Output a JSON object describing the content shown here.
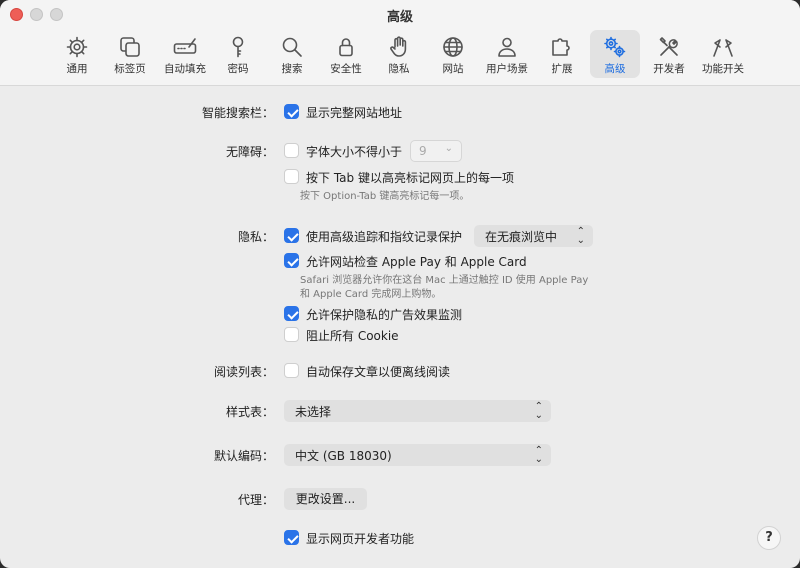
{
  "window": {
    "title": "高级"
  },
  "toolbar": {
    "tabs": [
      {
        "label": "通用",
        "icon": "gear-icon"
      },
      {
        "label": "标签页",
        "icon": "tabs-icon"
      },
      {
        "label": "自动填充",
        "icon": "pen-field-icon"
      },
      {
        "label": "密码",
        "icon": "key-icon"
      },
      {
        "label": "搜索",
        "icon": "search-icon"
      },
      {
        "label": "安全性",
        "icon": "lock-icon"
      },
      {
        "label": "隐私",
        "icon": "hand-icon"
      },
      {
        "label": "网站",
        "icon": "globe-icon"
      },
      {
        "label": "用户场景",
        "icon": "person-icon"
      },
      {
        "label": "扩展",
        "icon": "puzzle-icon"
      },
      {
        "label": "高级",
        "icon": "gears-icon",
        "active": true
      },
      {
        "label": "开发者",
        "icon": "wrench-screwdriver-icon"
      },
      {
        "label": "功能开关",
        "icon": "flags-icon"
      }
    ]
  },
  "settings": {
    "smart_search": {
      "label": "智能搜索栏：",
      "option": "显示完整网站地址",
      "checked": true
    },
    "accessibility": {
      "label": "无障碍：",
      "min_font": {
        "text": "字体大小不得小于",
        "checked": false,
        "value": "9"
      },
      "tab_highlight": {
        "text": "按下 Tab 键以高亮标记网页上的每一项",
        "checked": false
      },
      "tab_note": "按下 Option-Tab 键高亮标记每一项。"
    },
    "privacy": {
      "label": "隐私：",
      "tracking": {
        "text": "使用高级追踪和指纹记录保护",
        "checked": true,
        "popup": "在无痕浏览中"
      },
      "apple_pay": {
        "text": "允许网站检查 Apple Pay 和 Apple Card",
        "checked": true
      },
      "apple_pay_note_1": "Safari 浏览器允许你在这台 Mac 上通过触控 ID 使用 Apple Pay",
      "apple_pay_note_2": "和 Apple Card 完成网上购物。",
      "ad_measurement": {
        "text": "允许保护隐私的广告效果监测",
        "checked": true
      },
      "block_cookies": {
        "text": "阻止所有 Cookie",
        "checked": false
      }
    },
    "reading_list": {
      "label": "阅读列表：",
      "option": "自动保存文章以便离线阅读",
      "checked": false
    },
    "style_sheet": {
      "label": "样式表：",
      "value": "未选择"
    },
    "encoding": {
      "label": "默认编码：",
      "value": "中文 (GB 18030)"
    },
    "proxy": {
      "label": "代理：",
      "button": "更改设置..."
    },
    "developer": {
      "option": "显示网页开发者功能",
      "checked": true
    }
  },
  "help": {
    "label": "?"
  },
  "colors": {
    "accent": "#2a73e8",
    "close": "#ee5e57"
  }
}
